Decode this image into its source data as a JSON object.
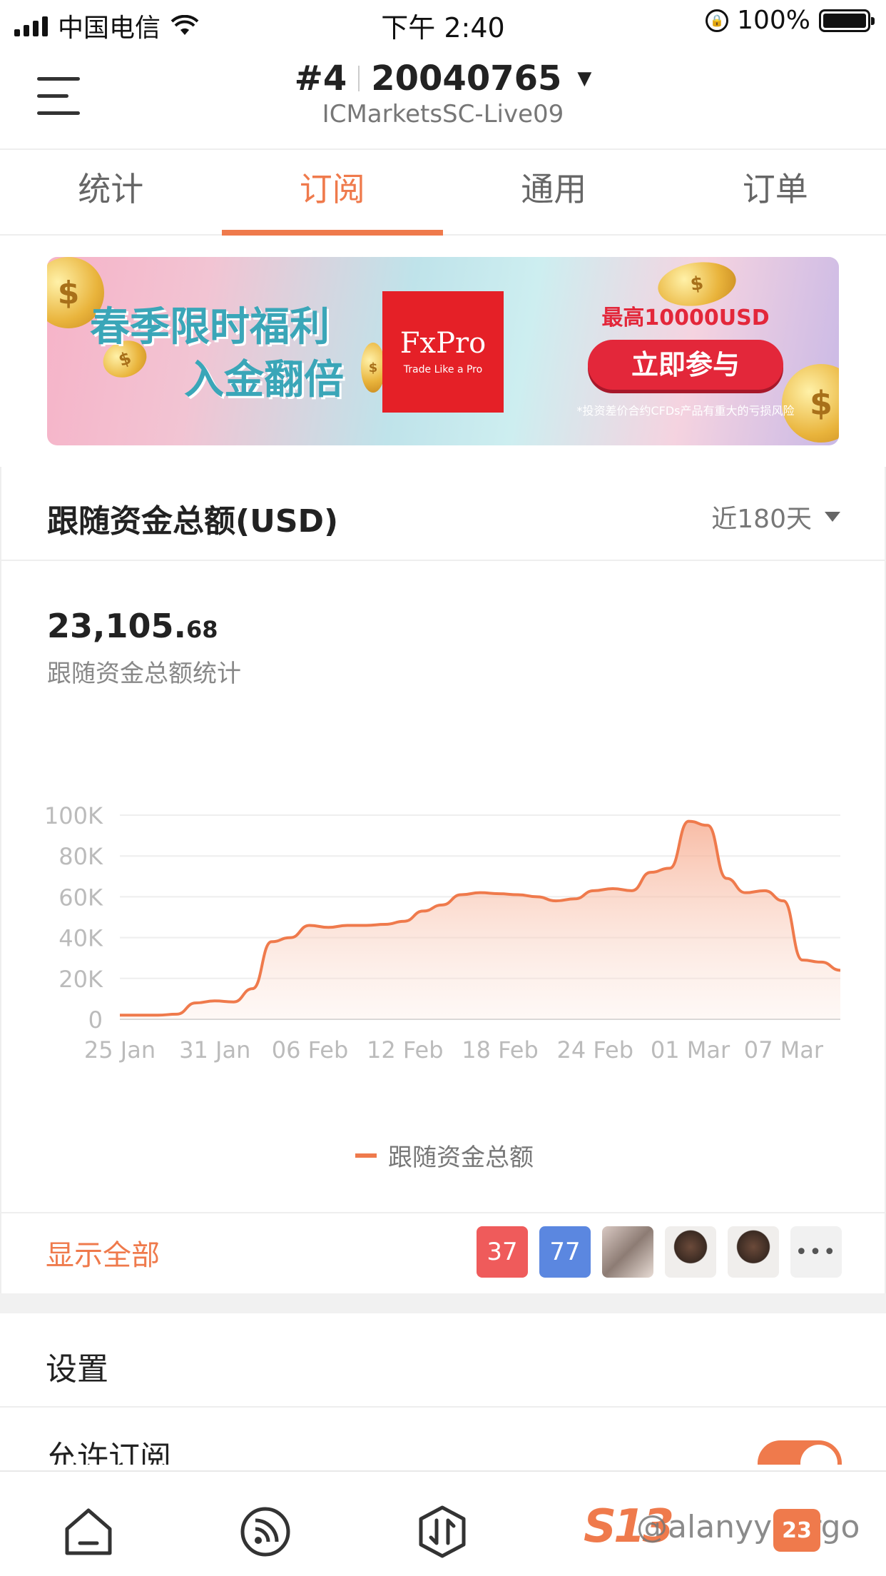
{
  "status_bar": {
    "carrier": "中国电信",
    "time": "下午 2:40",
    "battery": "100%"
  },
  "header": {
    "rank": "#4",
    "account": "20040765",
    "server": "ICMarketsSC-Live09"
  },
  "tabs": [
    {
      "label": "统计"
    },
    {
      "label": "订阅"
    },
    {
      "label": "通用"
    },
    {
      "label": "订单"
    }
  ],
  "banner": {
    "line1": "春季限时福利",
    "line2": "入金翻倍",
    "logo": "FxPro",
    "logo_tagline": "Trade Like a Pro",
    "max": "最高10000USD",
    "cta": "立即参与",
    "risk": "*投资差价合约CFDs产品有重大的亏损风险"
  },
  "funds_card": {
    "title": "跟随资金总额(USD)",
    "period": "近180天",
    "total_int": "23,105.",
    "total_dec": "68",
    "total_label": "跟随资金总额统计",
    "legend": "跟随资金总额",
    "show_all": "显示全部",
    "subscribers": [
      {
        "text": "37",
        "color": "#ef5b5b"
      },
      {
        "text": "77",
        "color": "#5b87e0"
      }
    ],
    "more": "•••"
  },
  "chart_data": {
    "type": "area",
    "series": [
      {
        "name": "跟随资金总额",
        "x": [
          "25 Jan",
          "27 Jan",
          "29 Jan",
          "31 Jan",
          "02 Feb",
          "03 Feb",
          "04 Feb",
          "05 Feb",
          "06 Feb",
          "07 Feb",
          "08 Feb",
          "09 Feb",
          "10 Feb",
          "11 Feb",
          "12 Feb",
          "13 Feb",
          "14 Feb",
          "15 Feb",
          "16 Feb",
          "17 Feb",
          "18 Feb",
          "19 Feb",
          "20 Feb",
          "21 Feb",
          "22 Feb",
          "23 Feb",
          "24 Feb",
          "25 Feb",
          "26 Feb",
          "27 Feb",
          "28 Feb",
          "29 Feb",
          "01 Mar",
          "02 Mar",
          "03 Mar",
          "04 Mar",
          "05 Mar",
          "06 Mar",
          "07 Mar"
        ],
        "values": [
          2000,
          2000,
          2000,
          2500,
          8000,
          9000,
          8500,
          15000,
          38000,
          40000,
          46000,
          45000,
          46000,
          46000,
          46500,
          48000,
          53000,
          56000,
          61000,
          62000,
          61500,
          61000,
          60000,
          58000,
          59000,
          63000,
          64000,
          63000,
          72000,
          74000,
          97000,
          95000,
          69000,
          62000,
          63000,
          58000,
          29000,
          28000,
          24000
        ]
      }
    ],
    "x_ticks": [
      "25 Jan",
      "31 Jan",
      "06 Feb",
      "12 Feb",
      "18 Feb",
      "24 Feb",
      "01 Mar",
      "07 Mar"
    ],
    "y_ticks": [
      "0",
      "20K",
      "40K",
      "60K",
      "80K",
      "100K"
    ],
    "ylim": [
      0,
      100000
    ],
    "grid": true,
    "legend_position": "bottom"
  },
  "settings": {
    "title": "设置",
    "allow_subscribe": "允许订阅"
  },
  "bottom_nav": {
    "brand": "S13",
    "watermark": "@alanyycargo",
    "badge": "23"
  },
  "colors": {
    "accent": "#ef7a4c"
  }
}
